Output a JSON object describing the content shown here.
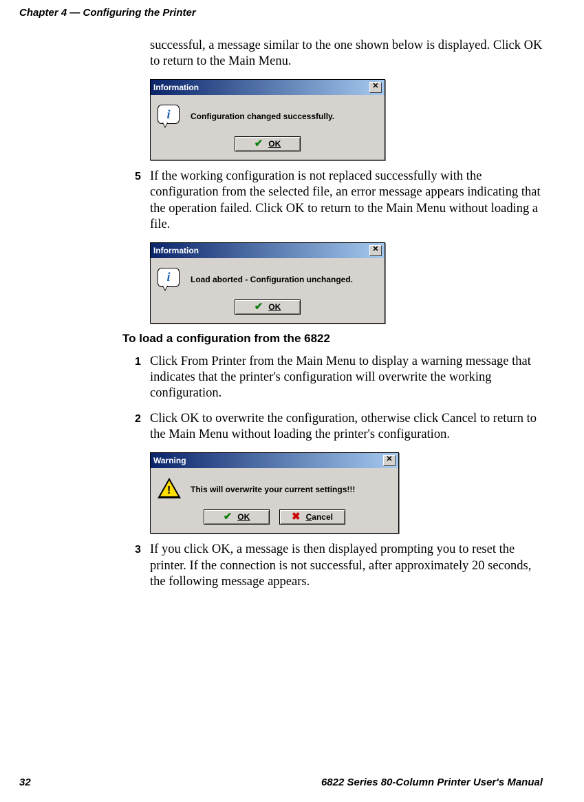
{
  "header": {
    "chapter": "Chapter 4 — Configuring the Printer"
  },
  "intro_text": "successful, a message similar to the one shown below is displayed. Click OK to return to the Main Menu.",
  "dialog1": {
    "title": "Information",
    "close": "✕",
    "info_glyph": "i",
    "message": "Configuration changed successfully.",
    "ok": "OK"
  },
  "step5": {
    "num": "5",
    "text": "If the working configuration is not replaced successfully with the configuration from the selected file, an error message appears indicating that the operation failed. Click OK to return to the Main Menu without loading a file."
  },
  "dialog2": {
    "title": "Information",
    "close": "✕",
    "info_glyph": "i",
    "message": "Load aborted - Configuration unchanged.",
    "ok": "OK"
  },
  "subheading": "To load a configuration from the 6822",
  "step1": {
    "num": "1",
    "text": "Click From Printer from the Main Menu to display a warning message that indicates that the printer's configuration will overwrite the working configuration."
  },
  "step2": {
    "num": "2",
    "text": "Click OK to overwrite the configuration, otherwise click Cancel to return to the Main Menu without loading the printer's configuration."
  },
  "dialog3": {
    "title": "Warning",
    "close": "✕",
    "bang": "!",
    "message": "This will overwrite your current settings!!!",
    "ok": "OK",
    "cancel": "Cancel"
  },
  "step3": {
    "num": "3",
    "text": "If you click OK, a message is then displayed prompting you to reset the printer. If the connection is not successful, after approximately 20 seconds, the following message appears."
  },
  "footer": {
    "page": "32",
    "title": "6822 Series 80-Column Printer User's Manual"
  }
}
